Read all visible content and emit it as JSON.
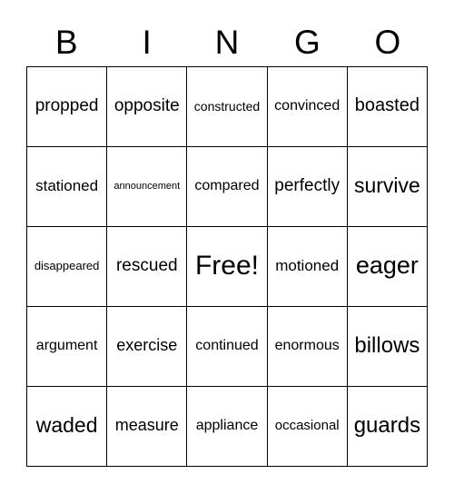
{
  "header": [
    "B",
    "I",
    "N",
    "G",
    "O"
  ],
  "cells": [
    "propped",
    "opposite",
    "constructed",
    "convinced",
    "boasted",
    "stationed",
    "announcement",
    "compared",
    "perfectly",
    "survive",
    "disappeared",
    "rescued",
    "Free!",
    "motioned",
    "eager",
    "argument",
    "exercise",
    "continued",
    "enormous",
    "billows",
    "waded",
    "measure",
    "appliance",
    "occasional",
    "guards"
  ]
}
